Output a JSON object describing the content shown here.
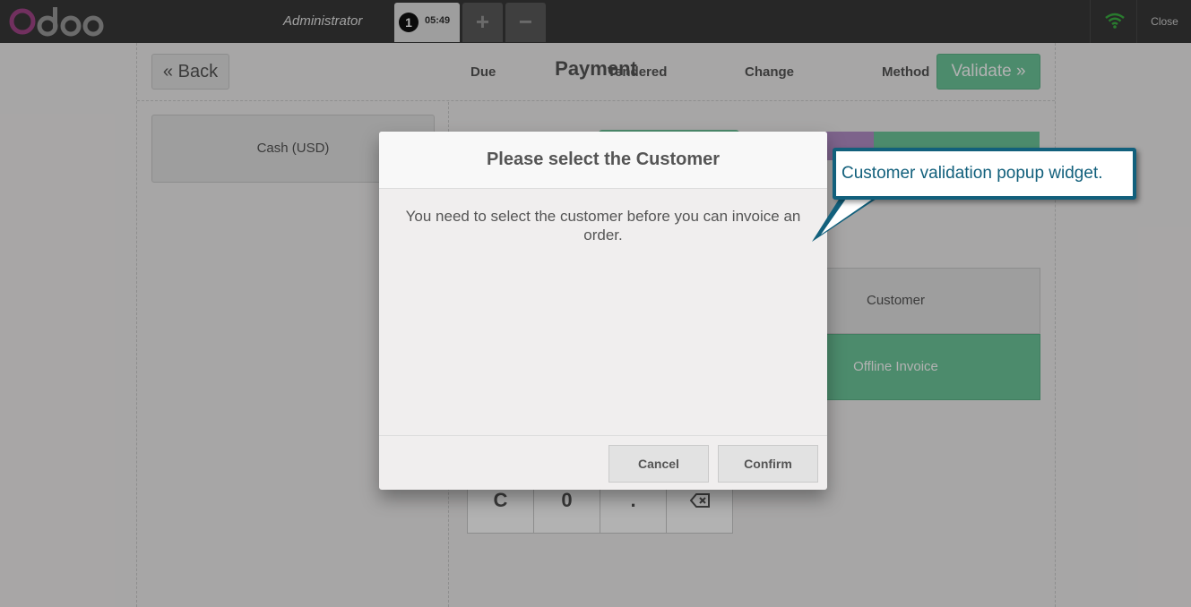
{
  "header": {
    "user": "Administrator",
    "order_number": "1",
    "order_time": "05:49",
    "add_tab": "+",
    "remove_tab": "−",
    "close": "Close"
  },
  "payment": {
    "back_label": "Back",
    "title": "Payment",
    "validate_label": "Validate",
    "methods": [
      "Cash (USD)"
    ],
    "columns": [
      "Due",
      "Tendered",
      "Change",
      "Method"
    ],
    "customer_label": "Customer",
    "invoice_label": "Offline Invoice",
    "numpad": [
      "C",
      "0",
      "."
    ]
  },
  "modal": {
    "title": "Please select the Customer",
    "body": "You need to select the customer before you can invoice an order.",
    "cancel": "Cancel",
    "confirm": "Confirm"
  },
  "annotation": {
    "text": "Customer validation popup widget."
  },
  "colors": {
    "header_bg": "#393939",
    "accent_green": "#6ec89b",
    "accent_purple": "#b48fc8",
    "callout_border": "#12607c",
    "logo_purple": "#a24689"
  },
  "icons": {
    "back": "double-chevron-left-icon",
    "validate": "double-chevron-right-icon",
    "wifi": "wifi-icon",
    "backspace": "backspace-icon"
  }
}
